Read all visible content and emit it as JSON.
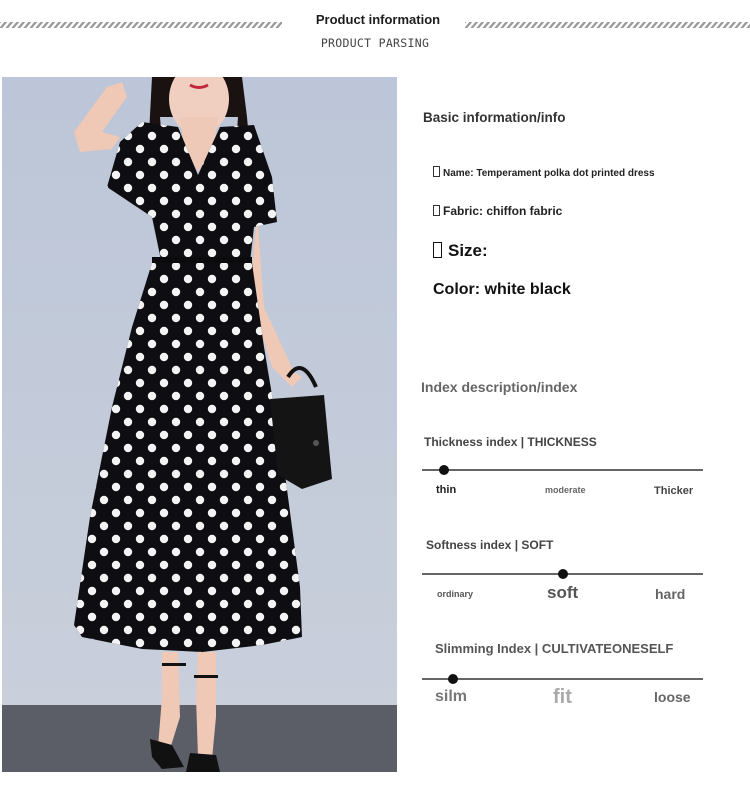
{
  "header": {
    "title": "Product information",
    "subtitle": "PRODUCT PARSING"
  },
  "basic": {
    "heading": "Basic information/info",
    "name": "Name: Temperament polka dot printed dress",
    "fabric": "Fabric: chiffon fabric",
    "size": "Size:",
    "color": "Color: white black"
  },
  "index": {
    "heading": "Index description/index",
    "scales": [
      {
        "title": "Thickness index | THICKNESS",
        "labels": [
          "thin",
          "moderate",
          "Thicker"
        ],
        "value": 0.08
      },
      {
        "title": "Softness index | SOFT",
        "labels": [
          "ordinary",
          "soft",
          "hard"
        ],
        "value": 0.5
      },
      {
        "title": "Slimming Index | CULTIVATEONESELF",
        "labels": [
          "silm",
          "fit",
          "loose"
        ],
        "value": 0.11
      }
    ]
  },
  "colors": {
    "dress": "#0e0e12",
    "dots": "#ffffff",
    "background": "#c2cadb",
    "floor": "#5b5e66"
  }
}
